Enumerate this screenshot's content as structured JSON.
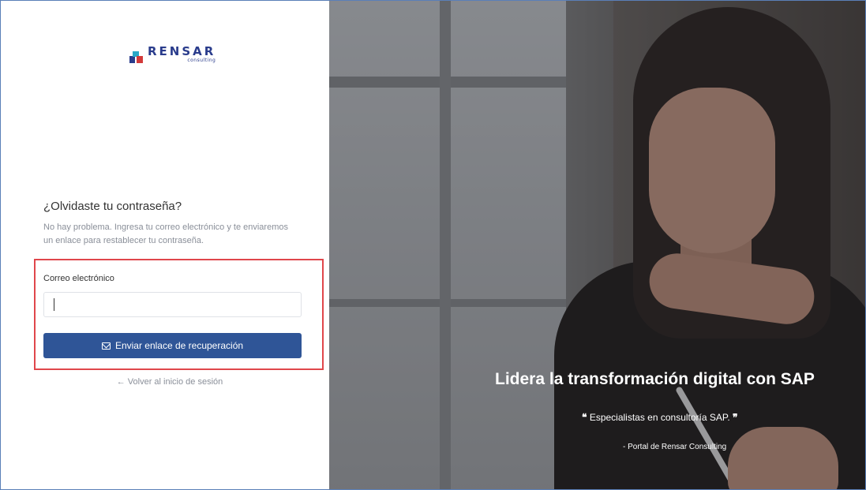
{
  "logo": {
    "brand": "RENSAR",
    "sub": "consulting",
    "colors": {
      "blue": "#2a3c8c",
      "teal": "#2aa8c7",
      "red": "#d33a3a"
    }
  },
  "form": {
    "title": "¿Olvidaste tu contraseña?",
    "description": "No hay problema. Ingresa tu correo electrónico y te enviaremos un enlace para restablecer tu contraseña.",
    "email_label": "Correo electrónico",
    "email_value": "",
    "submit_label": "Enviar enlace de recuperación",
    "submit_icon": "mail-icon",
    "back_link": "← Volver al inicio de sesión"
  },
  "hero": {
    "headline": "Lidera la transformación digital con SAP",
    "quote": "Especialistas en consultoría SAP.",
    "quote_open": "❝",
    "quote_close": "❞",
    "author": "- Portal de Rensar Consulting"
  },
  "colors": {
    "primary": "#2f5597",
    "highlight_border": "#e0474b",
    "muted_text": "#8a8f99"
  }
}
